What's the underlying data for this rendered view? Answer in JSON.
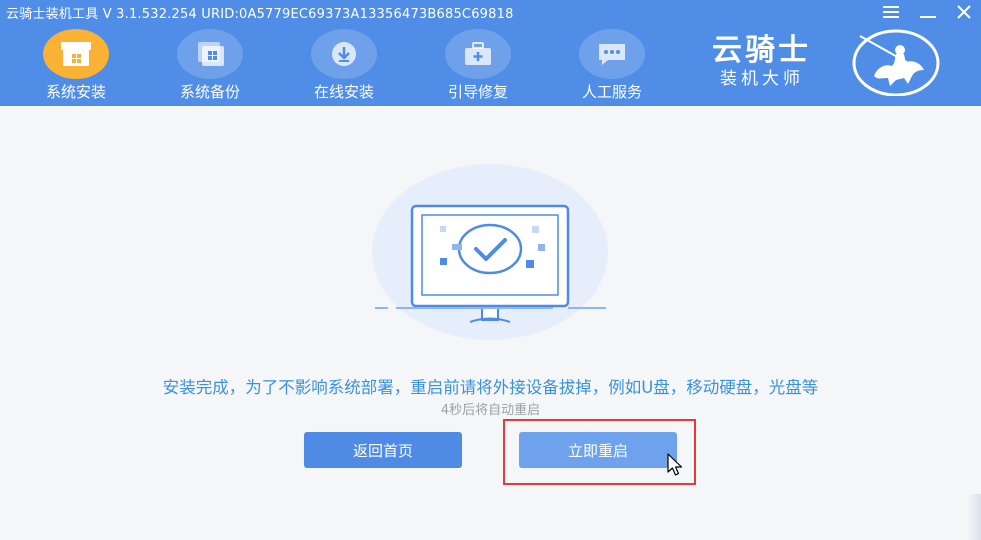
{
  "window": {
    "title": "云骑士装机工具 V 3.1.532.254 URID:0A5779EC69373A13356473B685C69818",
    "controls": [
      "menu-icon",
      "minimize-icon",
      "close-icon"
    ]
  },
  "nav": {
    "items": [
      {
        "label": "系统安装",
        "icon": "install-box-icon",
        "active": true
      },
      {
        "label": "系统备份",
        "icon": "backup-windows-icon",
        "active": false
      },
      {
        "label": "在线安装",
        "icon": "download-icon",
        "active": false
      },
      {
        "label": "引导修复",
        "icon": "toolbox-icon",
        "active": false
      },
      {
        "label": "人工服务",
        "icon": "chat-icon",
        "active": false
      }
    ]
  },
  "brand": {
    "name": "云骑士",
    "subtitle": "装机大师",
    "emblem": "knight-horse-icon"
  },
  "main": {
    "illustration": "monitor-check-icon",
    "message": "安装完成，为了不影响系统部署，重启前请将外接设备拔掉，例如U盘，移动硬盘，光盘等",
    "countdown": "4秒后将自动重启",
    "back_button": "返回首页",
    "restart_button": "立即重启"
  },
  "colors": {
    "header": "#4f8de6",
    "active_nav": "#f9b233",
    "message_text": "#3a92dc",
    "button_primary": "#4f8be5",
    "button_hover": "#6fa2ec",
    "highlight": "#e23b3b"
  }
}
